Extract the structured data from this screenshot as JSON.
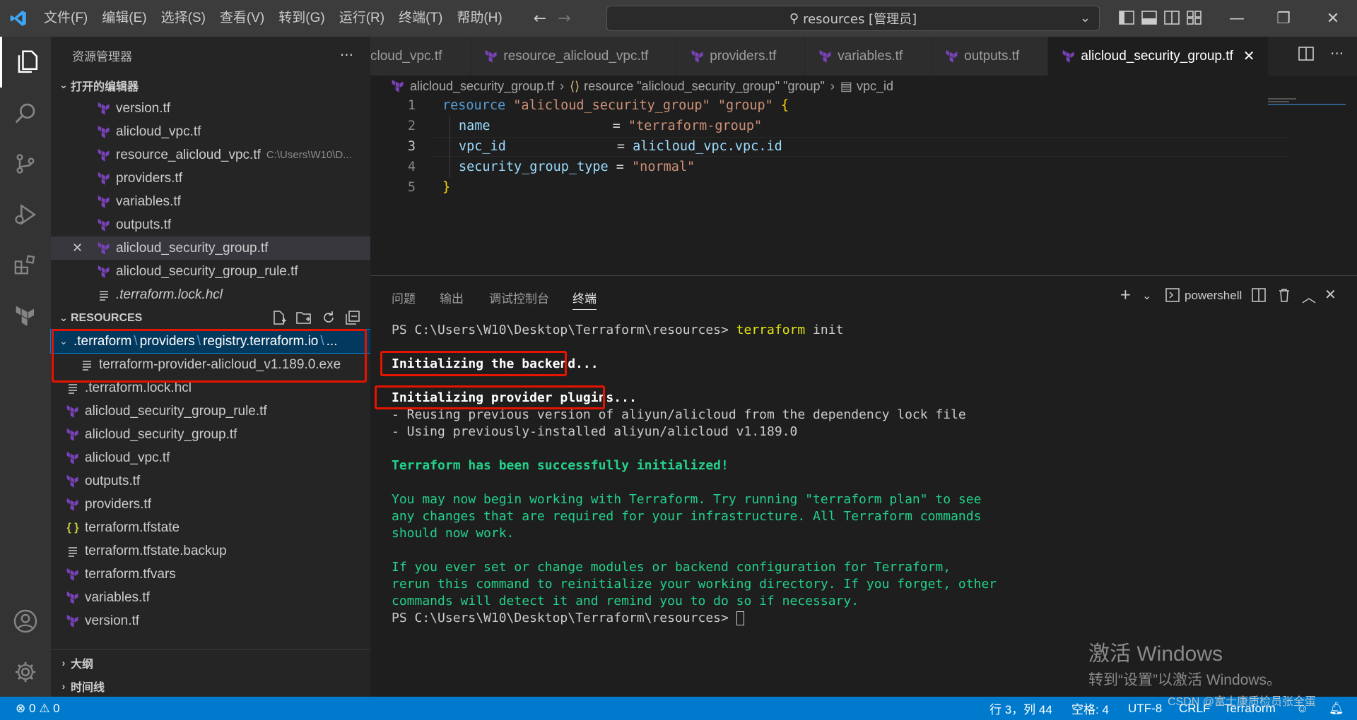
{
  "titlebar": {
    "menu": [
      "文件(F)",
      "编辑(E)",
      "选择(S)",
      "查看(V)",
      "转到(G)",
      "运行(R)",
      "终端(T)",
      "帮助(H)"
    ],
    "search": "resources [管理员]"
  },
  "sidebar": {
    "title": "资源管理器",
    "open_editors_label": "打开的编辑器",
    "open_editors": [
      {
        "name": "version.tf",
        "icon": "terraform-icon"
      },
      {
        "name": "alicloud_vpc.tf",
        "icon": "terraform-icon"
      },
      {
        "name": "resource_alicloud_vpc.tf",
        "icon": "terraform-icon",
        "hint": "C:\\Users\\W10\\D..."
      },
      {
        "name": "providers.tf",
        "icon": "terraform-icon"
      },
      {
        "name": "variables.tf",
        "icon": "terraform-icon"
      },
      {
        "name": "outputs.tf",
        "icon": "terraform-icon"
      },
      {
        "name": "alicloud_security_group.tf",
        "icon": "terraform-icon"
      },
      {
        "name": "alicloud_security_group_rule.tf",
        "icon": "terraform-icon"
      },
      {
        "name": ".terraform.lock.hcl",
        "icon": "file-lines-icon"
      }
    ],
    "resources_label": "RESOURCES",
    "folder_path": [
      ".terraform",
      "providers",
      "registry.terraform.io",
      "..."
    ],
    "folder_child": "terraform-provider-alicloud_v1.189.0.exe",
    "files": [
      {
        "name": ".terraform.lock.hcl",
        "icon": "file-lines-icon"
      },
      {
        "name": "alicloud_security_group_rule.tf",
        "icon": "terraform-icon"
      },
      {
        "name": "alicloud_security_group.tf",
        "icon": "terraform-icon"
      },
      {
        "name": "alicloud_vpc.tf",
        "icon": "terraform-icon"
      },
      {
        "name": "outputs.tf",
        "icon": "terraform-icon"
      },
      {
        "name": "providers.tf",
        "icon": "terraform-icon"
      },
      {
        "name": "terraform.tfstate",
        "icon": "json-braces-icon"
      },
      {
        "name": "terraform.tfstate.backup",
        "icon": "file-lines-icon"
      },
      {
        "name": "terraform.tfvars",
        "icon": "terraform-icon"
      },
      {
        "name": "variables.tf",
        "icon": "terraform-icon"
      },
      {
        "name": "version.tf",
        "icon": "terraform-icon"
      }
    ],
    "outline_label": "大纲",
    "timeline_label": "时间线"
  },
  "tabs": [
    {
      "label": "cloud_vpc.tf"
    },
    {
      "label": "resource_alicloud_vpc.tf"
    },
    {
      "label": "providers.tf"
    },
    {
      "label": "variables.tf"
    },
    {
      "label": "outputs.tf"
    },
    {
      "label": "alicloud_security_group.tf",
      "active": true
    }
  ],
  "breadcrumb": {
    "file": "alicloud_security_group.tf",
    "symbol": "resource \"alicloud_security_group\" \"group\"",
    "field": "vpc_id"
  },
  "editor": {
    "line_numbers": [
      "1",
      "2",
      "3",
      "4",
      "5"
    ],
    "l1": {
      "kw": "resource",
      "s1": "\"alicloud_security_group\"",
      "s2": "\"group\"",
      "brace": "{"
    },
    "l2": {
      "key": "name",
      "eq": "=",
      "val": "\"terraform-group\""
    },
    "l3": {
      "key": "vpc_id",
      "eq": "=",
      "val": "alicloud_vpc.vpc.id"
    },
    "l4": {
      "key": "security_group_type",
      "eq": "=",
      "val": "\"normal\""
    },
    "l5": {
      "brace": "}"
    }
  },
  "panel": {
    "tabs": [
      "问题",
      "输出",
      "调试控制台",
      "终端"
    ],
    "shell": "powershell",
    "terminal": {
      "prompt1": "PS C:\\Users\\W10\\Desktop\\Terraform\\resources> ",
      "cmd": "terraform",
      "arg": " init",
      "backend": "Initializing the backend...",
      "plugins": "Initializing provider plugins...",
      "reuse": "- Reusing previous version of aliyun/alicloud from the dependency lock file",
      "using": "- Using previously-installed aliyun/alicloud v1.189.0",
      "success": "Terraform has been successfully initialized!",
      "g1": "You may now begin working with Terraform. Try running \"terraform plan\" to see",
      "g2": "any changes that are required for your infrastructure. All Terraform commands",
      "g3": "should now work.",
      "g4": "If you ever set or change modules or backend configuration for Terraform,",
      "g5": "rerun this command to reinitialize your working directory. If you forget, other",
      "g6": "commands will detect it and remind you to do so if necessary.",
      "prompt2": "PS C:\\Users\\W10\\Desktop\\Terraform\\resources> "
    }
  },
  "watermark": {
    "line1": "激活 Windows",
    "line2": "转到“设置”以激活 Windows。"
  },
  "status": {
    "errors": "0",
    "warnings": "0",
    "position": "行 3，列 44",
    "spaces": "空格: 4",
    "encoding": "UTF-8",
    "eol": "CRLF",
    "language": "Terraform",
    "csdn": "CSDN @富士康质检员张全蛋"
  },
  "colors": {
    "accent": "#007acc",
    "terraform": "#7b42bc",
    "highlight_box": "#e51400",
    "terminal_green": "#23d18b"
  }
}
